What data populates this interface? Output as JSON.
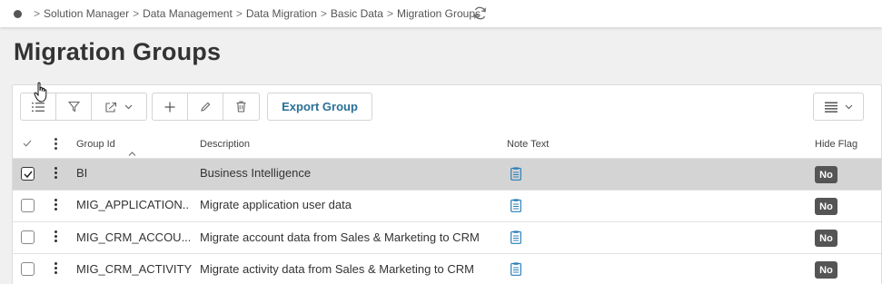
{
  "breadcrumb": {
    "items": [
      "Solution Manager",
      "Data Management",
      "Data Migration",
      "Basic Data",
      "Migration Groups"
    ],
    "separator": ">"
  },
  "page": {
    "title": "Migration Groups"
  },
  "toolbar": {
    "export_label": "Export Group"
  },
  "table": {
    "columns": {
      "group_id": "Group Id",
      "description": "Description",
      "note_text": "Note Text",
      "hide_flag": "Hide Flag"
    },
    "sort": {
      "column": "group_id",
      "direction": "ascending"
    },
    "rows": [
      {
        "group_id": "BI",
        "description": "Business Intelligence",
        "hide_flag": "No",
        "selected": true
      },
      {
        "group_id": "MIG_APPLICATION...",
        "description": "Migrate application user data",
        "hide_flag": "No",
        "selected": false
      },
      {
        "group_id": "MIG_CRM_ACCOU...",
        "description": "Migrate account data from Sales & Marketing to CRM",
        "hide_flag": "No",
        "selected": false
      },
      {
        "group_id": "MIG_CRM_ACTIVITY",
        "description": "Migrate activity data from Sales & Marketing to CRM",
        "hide_flag": "No",
        "selected": false
      }
    ]
  },
  "colors": {
    "accent": "#2a6f97",
    "note_icon": "#2a7fb8",
    "badge": "#555555",
    "selected_row": "#d4d4d4"
  },
  "icons": [
    "home-dot-icon",
    "refresh-icon",
    "list-icon",
    "filter-icon",
    "export-icon",
    "chevron-down-icon",
    "add-icon",
    "edit-icon",
    "delete-icon",
    "table-view-icon",
    "kebab-icon",
    "note-icon",
    "sort-asc-icon",
    "check-all-icon"
  ]
}
